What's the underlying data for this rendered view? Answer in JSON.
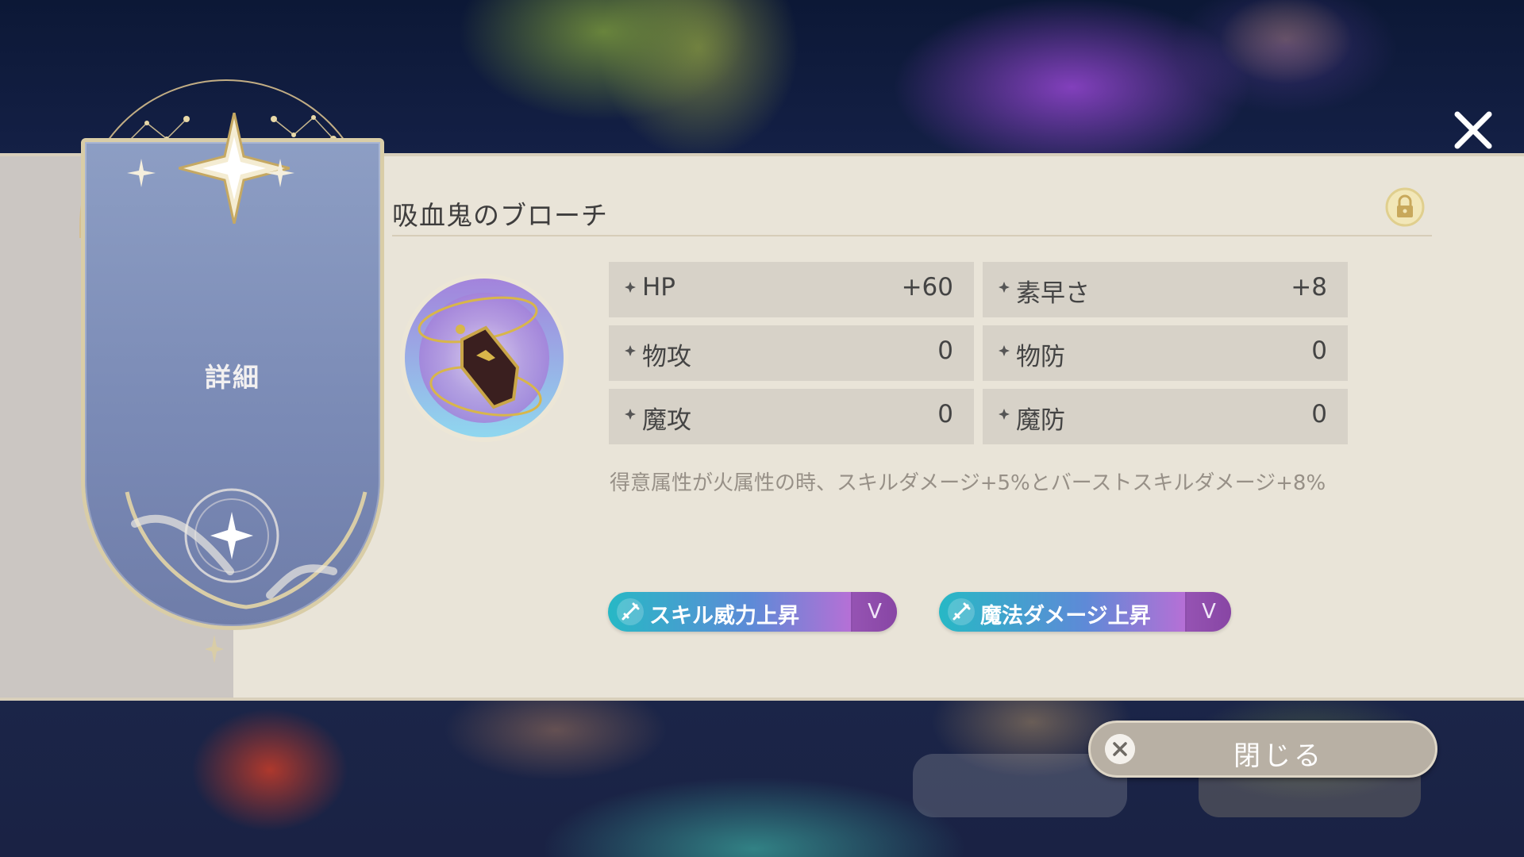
{
  "tab": {
    "label": "詳細"
  },
  "item": {
    "name": "吸血鬼のブローチ",
    "locked": true,
    "icon": "vampire-coffin-brooch-icon"
  },
  "stats": [
    {
      "label": "HP",
      "value": "+60"
    },
    {
      "label": "素早さ",
      "value": "+8"
    },
    {
      "label": "物攻",
      "value": "0"
    },
    {
      "label": "物防",
      "value": "0"
    },
    {
      "label": "魔攻",
      "value": "0"
    },
    {
      "label": "魔防",
      "value": "0"
    }
  ],
  "description": "得意属性が火属性の時、スキルダメージ+5%とバーストスキルダメージ+8%",
  "tags": [
    {
      "label": "スキル威力上昇",
      "level": "V"
    },
    {
      "label": "魔法ダメージ上昇",
      "level": "V"
    }
  ],
  "buttons": {
    "close": "閉じる"
  },
  "colors": {
    "panel": "#e9e4d8",
    "tab": "#7f8fb9",
    "tag_gradient_start": "#27b8c5",
    "tag_gradient_end": "#b86fd6"
  }
}
